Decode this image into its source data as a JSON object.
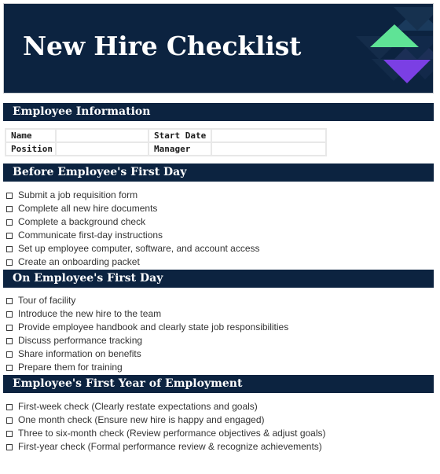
{
  "document": {
    "title": "New Hire Checklist"
  },
  "theme": {
    "navy": "#0c2340",
    "green": "#5fe396",
    "purple": "#7b3fe4",
    "text": "#333333",
    "table_border": "#e8e8e8"
  },
  "decoration": {
    "name": "diamond-triangles-graphic"
  },
  "sections": [
    {
      "id": "employee-information",
      "heading": "Employee Information",
      "type": "table",
      "rows": [
        {
          "label_left": "Name",
          "value_left": "",
          "label_right": "Start Date",
          "value_right": ""
        },
        {
          "label_left": "Position",
          "value_left": "",
          "label_right": "Manager",
          "value_right": ""
        }
      ]
    },
    {
      "id": "before-first-day",
      "heading": "Before Employee's First Day",
      "type": "checklist",
      "items": [
        "Submit a job requisition form",
        "Complete all new hire documents",
        "Complete a background check",
        "Communicate first-day instructions",
        "Set up employee computer, software, and account access",
        "Create an onboarding packet"
      ]
    },
    {
      "id": "on-first-day",
      "heading": "On Employee's First Day",
      "type": "checklist",
      "items": [
        "Tour of facility",
        "Introduce the new hire to the team",
        "Provide employee handbook and clearly state job responsibilities",
        "Discuss performance tracking",
        "Share information on benefits",
        "Prepare them for training"
      ]
    },
    {
      "id": "first-year",
      "heading": "Employee's First Year of Employment",
      "type": "checklist",
      "items": [
        "First-week check (Clearly restate expectations and goals)",
        "One month check (Ensure new hire is happy and engaged)",
        "Three to six-month check (Review performance objectives & adjust goals)",
        "First-year check (Formal performance review & recognize achievements)"
      ]
    }
  ]
}
